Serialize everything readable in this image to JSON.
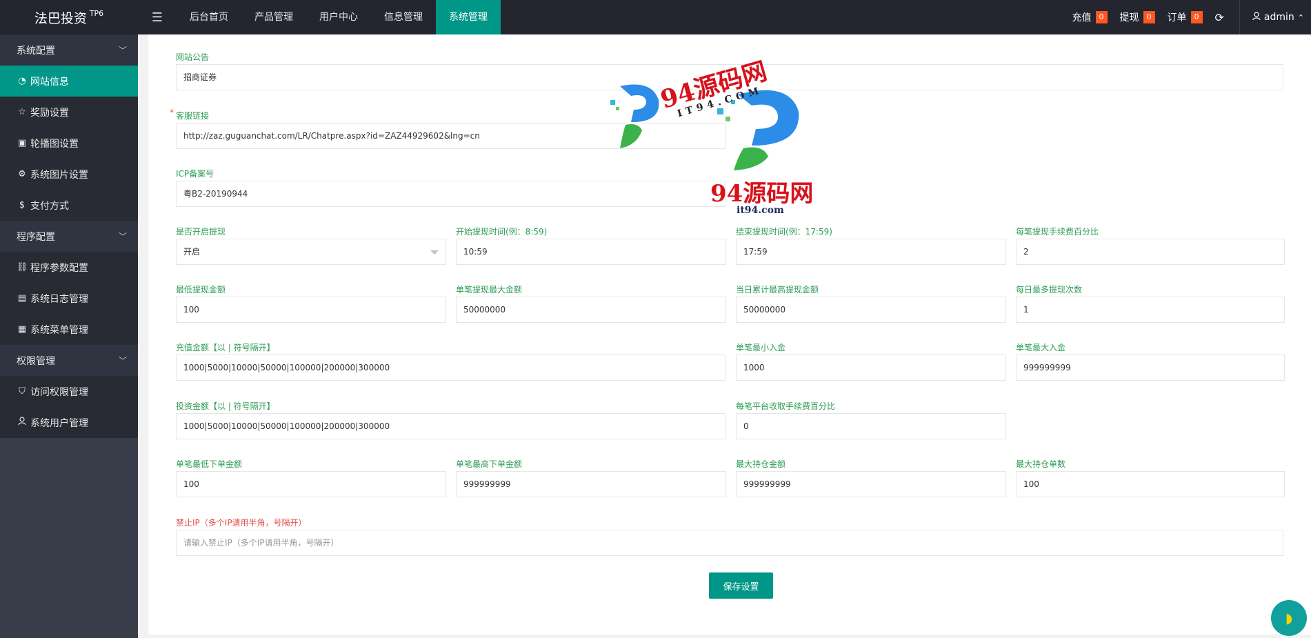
{
  "header": {
    "logo": "法巴投资",
    "logo_sup": "TP6",
    "menu_icon": "menu-icon",
    "nav": [
      "后台首页",
      "产品管理",
      "用户中心",
      "信息管理",
      "系统管理"
    ],
    "active_nav": "系统管理",
    "recharge_label": "充值",
    "recharge_count": "0",
    "withdraw_label": "提现",
    "withdraw_count": "0",
    "order_label": "订单",
    "order_count": "0",
    "user": "admin"
  },
  "sidebar": {
    "group1": "系统配置",
    "items1": [
      "网站信息",
      "奖励设置",
      "轮播图设置",
      "系统图片设置",
      "支付方式"
    ],
    "group2": "程序配置",
    "items2": [
      "程序参数配置",
      "系统日志管理",
      "系统菜单管理"
    ],
    "group3": "权限管理",
    "items3": [
      "访问权限管理",
      "系统用户管理"
    ]
  },
  "form": {
    "notice_label": "网站公告",
    "notice_value": "招商证券",
    "service_label": "客服链接",
    "service_value": "http://zaz.guguanchat.com/LR/Chatpre.aspx?id=ZAZ44929602&lng=cn",
    "icp_label": "ICP备案号",
    "icp_value": "粤B2-20190944",
    "withdraw_on_label": "是否开启提现",
    "withdraw_on_value": "开启",
    "start_label": "开始提现时间(例：8:59)",
    "start_value": "10:59",
    "end_label": "结束提现时间(例：17:59)",
    "end_value": "17:59",
    "fee_label": "每笔提现手续费百分比",
    "fee_value": "2",
    "min_wd_label": "最低提现金额",
    "min_wd_value": "100",
    "max_wd_label": "单笔提现最大金额",
    "max_wd_value": "50000000",
    "day_max_label": "当日累计最高提现金额",
    "day_max_value": "50000000",
    "day_times_label": "每日最多提现次数",
    "day_times_value": "1",
    "recharge_amt_label": "充值金额【以 | 符号隔开】",
    "recharge_amt_value": "1000|5000|10000|50000|100000|200000|300000",
    "min_in_label": "单笔最小入金",
    "min_in_value": "1000",
    "max_in_label": "单笔最大入金",
    "max_in_value": "999999999",
    "invest_amt_label": "投资金额【以 | 符号隔开】",
    "invest_amt_value": "1000|5000|10000|50000|100000|200000|300000",
    "platform_fee_label": "每笔平台收取手续费百分比",
    "platform_fee_value": "0",
    "min_order_label": "单笔最低下单金额",
    "min_order_value": "100",
    "max_order_label": "单笔最高下单金额",
    "max_order_value": "999999999",
    "max_hold_amt_label": "最大持仓金额",
    "max_hold_amt_value": "999999999",
    "max_hold_cnt_label": "最大持仓单数",
    "max_hold_cnt_value": "100",
    "ban_ip_label": "禁止IP（多个IP请用半角，号隔开）",
    "ban_ip_placeholder": "请输入禁止IP（多个IP请用半角，号隔开）",
    "save": "保存设置"
  },
  "watermark": {
    "text1": "94源码网",
    "text2": "IT94.COM",
    "text3": "94源码网",
    "text4": "it94.com"
  },
  "colors": {
    "accent": "#009688",
    "header": "#23262e",
    "sidebar": "#393d49",
    "badge": "#ff5722"
  }
}
